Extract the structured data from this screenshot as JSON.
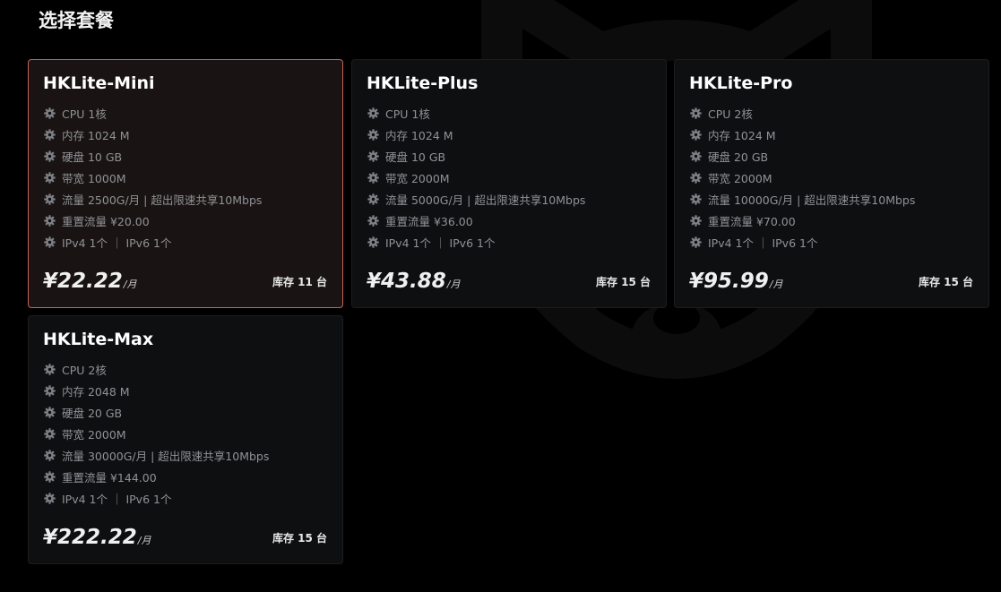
{
  "page": {
    "title": "选择套餐"
  },
  "plans": [
    {
      "name": "HKLite-Mini",
      "features": [
        "CPU 1核",
        "内存 1024 M",
        "硬盘 10 GB",
        "带宽 1000M",
        "流量 2500G/月 | 超出限速共享10Mbps",
        "重置流量 ¥20.00",
        "IPv4 1个 ｜ IPv6 1个"
      ],
      "price": "¥22.22",
      "price_unit": "/月",
      "stock": "库存 11 台",
      "selected": true
    },
    {
      "name": "HKLite-Plus",
      "features": [
        "CPU 1核",
        "内存 1024 M",
        "硬盘 10 GB",
        "带宽 2000M",
        "流量 5000G/月 | 超出限速共享10Mbps",
        "重置流量 ¥36.00",
        "IPv4 1个 ｜ IPv6 1个"
      ],
      "price": "¥43.88",
      "price_unit": "/月",
      "stock": "库存 15 台",
      "selected": false
    },
    {
      "name": "HKLite-Pro",
      "features": [
        "CPU 2核",
        "内存 1024 M",
        "硬盘 20 GB",
        "带宽 2000M",
        "流量 10000G/月 | 超出限速共享10Mbps",
        "重置流量 ¥70.00",
        "IPv4 1个 ｜ IPv6 1个"
      ],
      "price": "¥95.99",
      "price_unit": "/月",
      "stock": "库存 15 台",
      "selected": false
    },
    {
      "name": "HKLite-Max",
      "features": [
        "CPU 2核",
        "内存 2048 M",
        "硬盘 20 GB",
        "带宽 2000M",
        "流量 30000G/月 | 超出限速共享10Mbps",
        "重置流量 ¥144.00",
        "IPv4 1个 ｜ IPv6 1个"
      ],
      "price": "¥222.22",
      "price_unit": "/月",
      "stock": "库存 15 台",
      "selected": false
    }
  ],
  "icons": {
    "feature_bullet": "gear-icon",
    "background": "fox-watermark-icon"
  },
  "colors": {
    "background": "#000000",
    "card": "#0e0f11",
    "card_selected": "#1a1313",
    "selected_border": "#c9625a",
    "feature_text": "#8f9296"
  }
}
